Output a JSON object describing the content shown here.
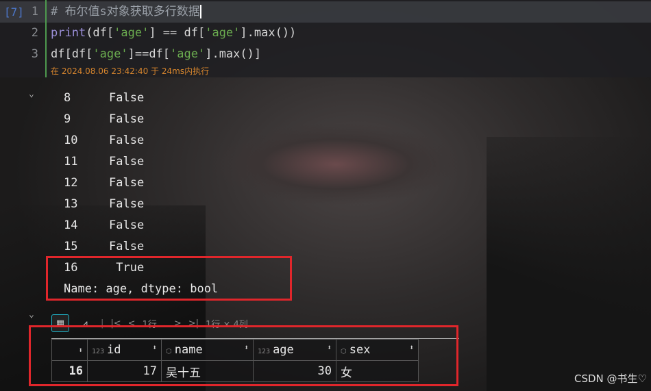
{
  "cell": {
    "badge": "[7]",
    "lines": [
      {
        "num": "1",
        "parts": [
          {
            "t": "# 布尔值s对象获取多行数据",
            "c": "cm"
          }
        ]
      },
      {
        "num": "2",
        "parts": [
          {
            "t": "print",
            "c": "kw"
          },
          {
            "t": "(df["
          },
          {
            "t": "'age'",
            "c": "str"
          },
          {
            "t": "] == df["
          },
          {
            "t": "'age'",
            "c": "str"
          },
          {
            "t": "].max())"
          }
        ]
      },
      {
        "num": "3",
        "parts": [
          {
            "t": "df[df["
          },
          {
            "t": "'age'",
            "c": "str"
          },
          {
            "t": "]==df["
          },
          {
            "t": "'age'",
            "c": "str"
          },
          {
            "t": "].max()]"
          }
        ]
      }
    ],
    "timestamp": "在 2024.08.06 23:42:40 于 24ms内执行"
  },
  "output": {
    "series": [
      [
        "8",
        "False"
      ],
      [
        "9",
        "False"
      ],
      [
        "10",
        "False"
      ],
      [
        "11",
        "False"
      ],
      [
        "12",
        "False"
      ],
      [
        "13",
        "False"
      ],
      [
        "14",
        "False"
      ],
      [
        "15",
        "False"
      ],
      [
        "16",
        " True"
      ]
    ],
    "footer": "Name: age, dtype: bool"
  },
  "toolbar": {
    "rows_select": "1行 ⌄",
    "shape": "1行 × 4列"
  },
  "table": {
    "columns": [
      {
        "name": "id",
        "type": "123"
      },
      {
        "name": "name",
        "type": "cube"
      },
      {
        "name": "age",
        "type": "123"
      },
      {
        "name": "sex",
        "type": "cube"
      }
    ],
    "rows": [
      {
        "index": "16",
        "id": "17",
        "name": "吴十五",
        "age": "30",
        "sex": "女"
      }
    ]
  },
  "watermark": "CSDN @书生♡",
  "colors": {
    "highlight": "#e0262b",
    "accent": "#1fb4c9",
    "string": "#6aab4f",
    "keyword": "#9b8fd8"
  }
}
